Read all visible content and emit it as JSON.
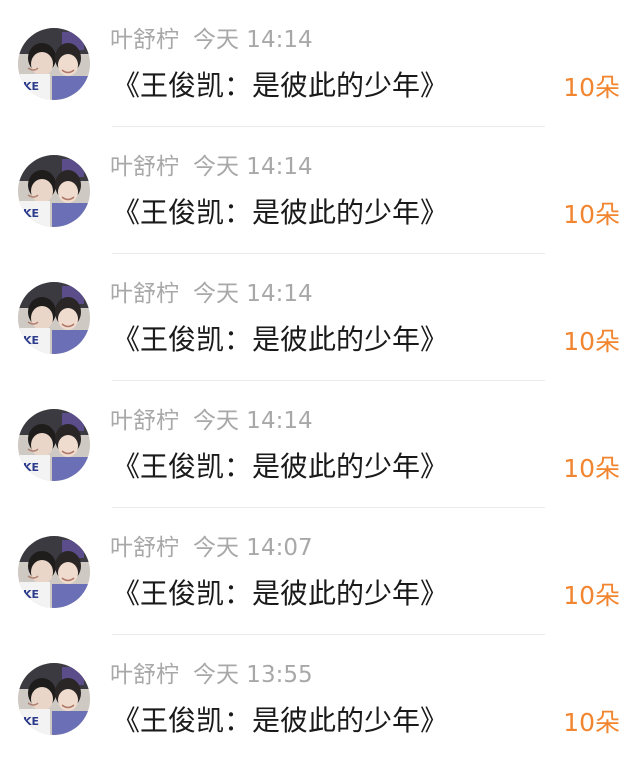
{
  "gift_list": [
    {
      "user": "叶舒柠",
      "time": "今天 14:14",
      "title": "《王俊凯：是彼此的少年》",
      "amount": "10朵"
    },
    {
      "user": "叶舒柠",
      "time": "今天 14:14",
      "title": "《王俊凯：是彼此的少年》",
      "amount": "10朵"
    },
    {
      "user": "叶舒柠",
      "time": "今天 14:14",
      "title": "《王俊凯：是彼此的少年》",
      "amount": "10朵"
    },
    {
      "user": "叶舒柠",
      "time": "今天 14:14",
      "title": "《王俊凯：是彼此的少年》",
      "amount": "10朵"
    },
    {
      "user": "叶舒柠",
      "time": "今天 14:07",
      "title": "《王俊凯：是彼此的少年》",
      "amount": "10朵"
    },
    {
      "user": "叶舒柠",
      "time": "今天 13:55",
      "title": "《王俊凯：是彼此的少年》",
      "amount": "10朵"
    }
  ],
  "colors": {
    "amount": "#f2852f",
    "meta": "#a8a8a8",
    "title": "#1a1a1a",
    "divider": "#ebebeb"
  },
  "icons": {
    "avatar": "user-photo-avatar"
  }
}
